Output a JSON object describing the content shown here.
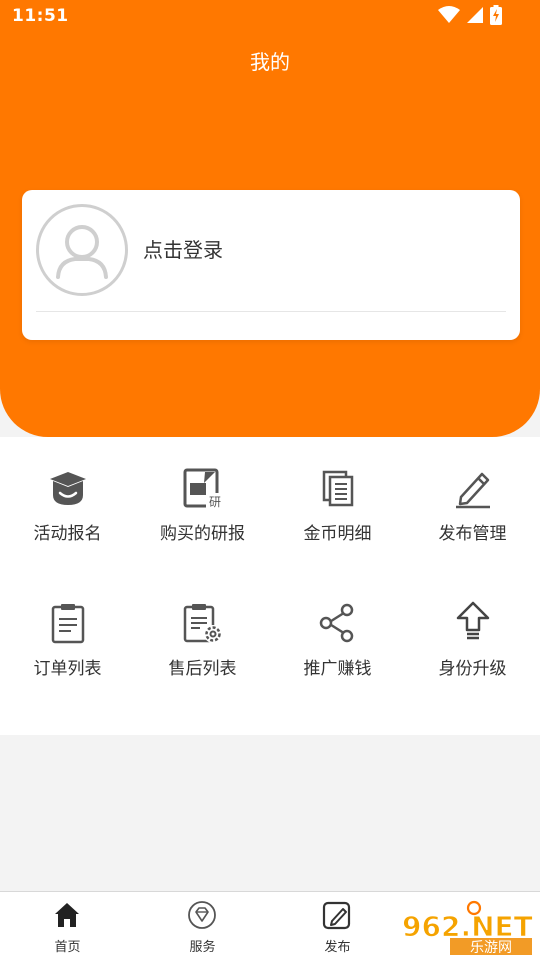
{
  "status_bar": {
    "time": "11:51"
  },
  "header": {
    "title": "我的"
  },
  "profile_card": {
    "login_text": "点击登录"
  },
  "menu": [
    {
      "label": "活动报名",
      "icon": "graduation-cap-icon"
    },
    {
      "label": "购买的研报",
      "icon": "research-report-icon"
    },
    {
      "label": "金币明细",
      "icon": "documents-icon"
    },
    {
      "label": "发布管理",
      "icon": "pencil-icon"
    },
    {
      "label": "订单列表",
      "icon": "clipboard-list-icon"
    },
    {
      "label": "售后列表",
      "icon": "clipboard-gear-icon"
    },
    {
      "label": "推广赚钱",
      "icon": "share-icon"
    },
    {
      "label": "身份升级",
      "icon": "arrow-up-icon"
    }
  ],
  "tabbar": [
    {
      "label": "首页",
      "icon": "home-icon"
    },
    {
      "label": "服务",
      "icon": "diamond-icon"
    },
    {
      "label": "发布",
      "icon": "edit-icon"
    },
    {
      "label": "",
      "icon": "profile-icon"
    }
  ],
  "watermark": {
    "text": "962.NET",
    "subtext": "乐游网"
  },
  "colors": {
    "brand": "#ff7800",
    "icon": "#444444",
    "background": "#f3f3f3"
  }
}
